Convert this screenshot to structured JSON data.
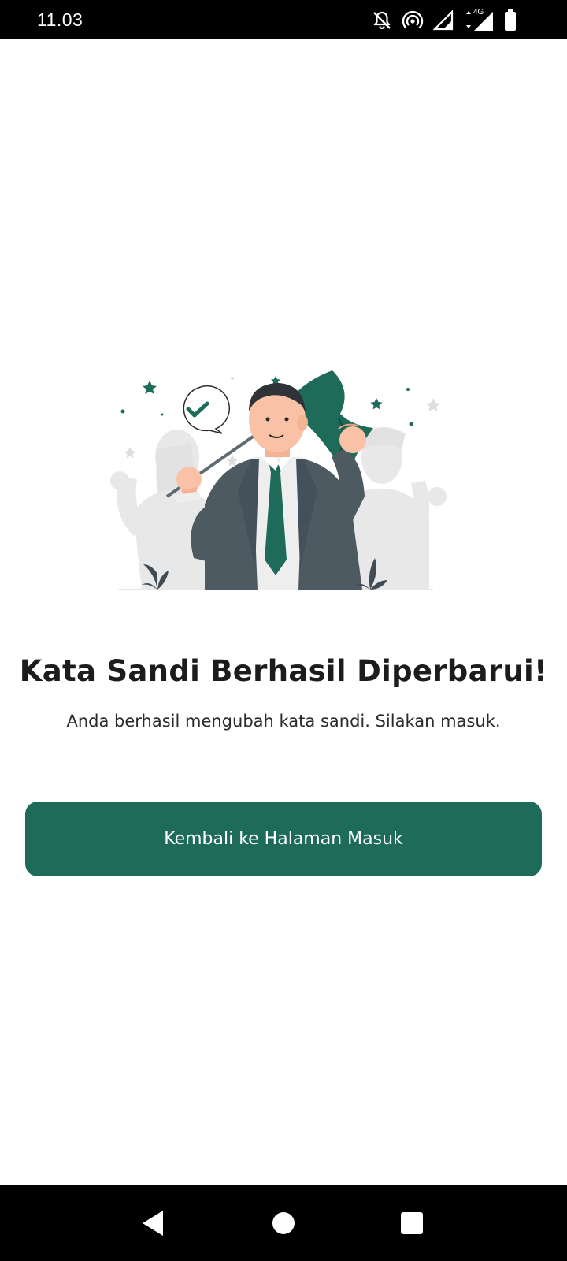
{
  "status_bar": {
    "time": "11.03",
    "network_label": "4G",
    "icons": [
      "notifications-off-icon",
      "hotspot-icon",
      "signal-icon",
      "signal-4g-icon",
      "battery-icon"
    ]
  },
  "main": {
    "illustration": "success-celebration-illustration",
    "title": "Kata Sandi Berhasil Diperbarui!",
    "subtitle": "Anda berhasil mengubah kata sandi. Silakan masuk.",
    "button_label": "Kembali ke Halaman Masuk"
  },
  "nav_bar": {
    "icons": [
      "back-icon",
      "home-icon",
      "recents-icon"
    ]
  },
  "colors": {
    "accent": "#1e6b5a",
    "status_bar_bg": "#000000",
    "text_dark": "#1c1c1c"
  }
}
